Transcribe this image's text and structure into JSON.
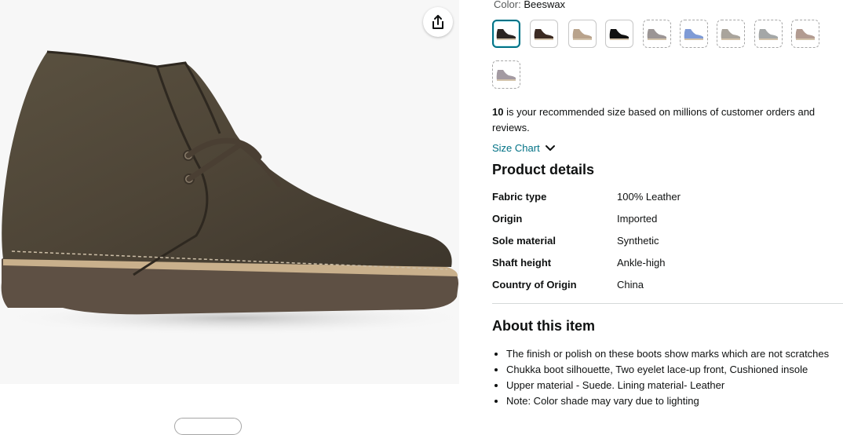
{
  "product": {
    "color_label": "Color:",
    "color_value": "Beeswax"
  },
  "swatches": [
    {
      "name": "swatch-1",
      "tone": "#2b2522",
      "selected": true
    },
    {
      "name": "swatch-2",
      "tone": "#3b2a22"
    },
    {
      "name": "swatch-3",
      "tone": "#b9a38c"
    },
    {
      "name": "swatch-4",
      "tone": "#111111"
    },
    {
      "name": "swatch-5",
      "tone": "#9b9595"
    },
    {
      "name": "swatch-6",
      "tone": "#7f9bd6"
    },
    {
      "name": "swatch-7",
      "tone": "#a9a49c"
    },
    {
      "name": "swatch-8",
      "tone": "#a4a7a7"
    },
    {
      "name": "swatch-9",
      "tone": "#b29b91"
    },
    {
      "name": "swatch-10",
      "tone": "#a39aa2"
    }
  ],
  "recommendation": {
    "size": "10",
    "text": " is your recommended size based on millions of customer orders and reviews."
  },
  "size_chart_label": "Size Chart",
  "product_details": {
    "heading": "Product details",
    "rows": [
      {
        "key": "Fabric type",
        "value": "100% Leather"
      },
      {
        "key": "Origin",
        "value": "Imported"
      },
      {
        "key": "Sole material",
        "value": "Synthetic"
      },
      {
        "key": "Shaft height",
        "value": "Ankle-high"
      },
      {
        "key": "Country of Origin",
        "value": "China"
      }
    ]
  },
  "about": {
    "heading": "About this item",
    "bullets": [
      "The finish or polish on these boots show marks which are not scratches",
      "Chukka boot silhouette, Two eyelet lace-up front, Cushioned insole",
      "Upper material - Suede. Lining material- Leather",
      "Note: Color shade may vary due to lighting"
    ]
  },
  "icons": {
    "share": "share-icon",
    "chevron": "chevron-down-icon"
  },
  "colors": {
    "link": "#007185",
    "selected_border": "#007185",
    "divider": "#d5d9d9"
  }
}
